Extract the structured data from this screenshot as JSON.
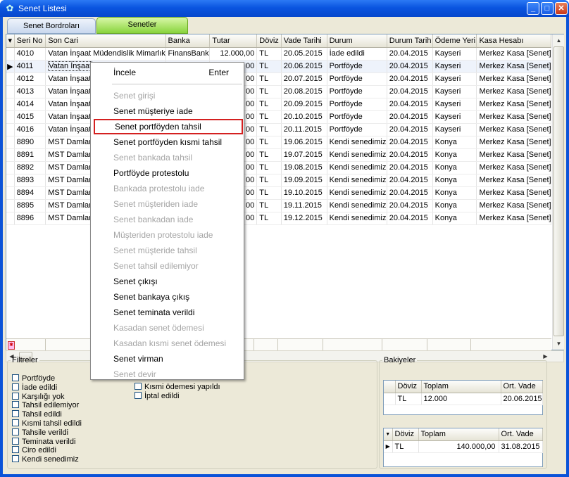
{
  "window": {
    "title": "Senet Listesi",
    "controls": {
      "minimize": "_",
      "maximize": "□",
      "close": "✕"
    }
  },
  "tabs": [
    {
      "label": "Senet Bordroları",
      "active": false
    },
    {
      "label": "Senetler",
      "active": true
    }
  ],
  "grid": {
    "columns": [
      "Seri No",
      "Son Cari",
      "Banka",
      "Tutar",
      "Döviz",
      "Vade Tarihi",
      "Durum",
      "Durum Tarih",
      "Ödeme Yeri",
      "Kasa Hesabı"
    ],
    "rows": [
      [
        "4010",
        "Vatan İnşaat Müdendislik Mimarlık",
        "FinansBank",
        "12.000,00",
        "TL",
        "20.05.2015",
        "İade edildi",
        "20.04.2015",
        "Kayseri",
        "Merkez Kasa [Senet]"
      ],
      [
        "4011",
        "Vatan İnşaat",
        "",
        "00",
        "TL",
        "20.06.2015",
        "Portföyde",
        "20.04.2015",
        "Kayseri",
        "Merkez Kasa [Senet]"
      ],
      [
        "4012",
        "Vatan İnşaat",
        "",
        "00",
        "TL",
        "20.07.2015",
        "Portföyde",
        "20.04.2015",
        "Kayseri",
        "Merkez Kasa [Senet]"
      ],
      [
        "4013",
        "Vatan İnşaat",
        "",
        "00",
        "TL",
        "20.08.2015",
        "Portföyde",
        "20.04.2015",
        "Kayseri",
        "Merkez Kasa [Senet]"
      ],
      [
        "4014",
        "Vatan İnşaat",
        "",
        "00",
        "TL",
        "20.09.2015",
        "Portföyde",
        "20.04.2015",
        "Kayseri",
        "Merkez Kasa [Senet]"
      ],
      [
        "4015",
        "Vatan İnşaat",
        "",
        "00",
        "TL",
        "20.10.2015",
        "Portföyde",
        "20.04.2015",
        "Kayseri",
        "Merkez Kasa [Senet]"
      ],
      [
        "4016",
        "Vatan İnşaat",
        "",
        "00",
        "TL",
        "20.11.2015",
        "Portföyde",
        "20.04.2015",
        "Kayseri",
        "Merkez Kasa [Senet]"
      ],
      [
        "8890",
        "MST Damlam",
        "",
        "00",
        "TL",
        "19.06.2015",
        "Kendi senedimiz",
        "20.04.2015",
        "Konya",
        "Merkez Kasa [Senet]"
      ],
      [
        "8891",
        "MST Damlam",
        "",
        "00",
        "TL",
        "19.07.2015",
        "Kendi senedimiz",
        "20.04.2015",
        "Konya",
        "Merkez Kasa [Senet]"
      ],
      [
        "8892",
        "MST Damlam",
        "",
        "00",
        "TL",
        "19.08.2015",
        "Kendi senedimiz",
        "20.04.2015",
        "Konya",
        "Merkez Kasa [Senet]"
      ],
      [
        "8893",
        "MST Damlam",
        "",
        "00",
        "TL",
        "19.09.2015",
        "Kendi senedimiz",
        "20.04.2015",
        "Konya",
        "Merkez Kasa [Senet]"
      ],
      [
        "8894",
        "MST Damlam",
        "",
        "00",
        "TL",
        "19.10.2015",
        "Kendi senedimiz",
        "20.04.2015",
        "Konya",
        "Merkez Kasa [Senet]"
      ],
      [
        "8895",
        "MST Damlam",
        "",
        "00",
        "TL",
        "19.11.2015",
        "Kendi senedimiz",
        "20.04.2015",
        "Konya",
        "Merkez Kasa [Senet]"
      ],
      [
        "8896",
        "MST Damlam",
        "",
        "00",
        "TL",
        "19.12.2015",
        "Kendi senedimiz",
        "20.04.2015",
        "Konya",
        "Merkez Kasa [Senet]"
      ]
    ],
    "selected_row": 1
  },
  "context_menu": {
    "items": [
      {
        "label": "İncele",
        "shortcut": "Enter",
        "enabled": true
      },
      {
        "sep": true
      },
      {
        "label": "Senet girişi",
        "enabled": false
      },
      {
        "label": "Senet müşteriye iade",
        "enabled": true
      },
      {
        "label": "Senet portföyden tahsil",
        "enabled": true,
        "highlighted": true
      },
      {
        "label": "Senet portföyden kısmi tahsil",
        "enabled": true
      },
      {
        "label": "Senet bankada tahsil",
        "enabled": false
      },
      {
        "label": "Portföyde protestolu",
        "enabled": true
      },
      {
        "label": "Bankada protestolu iade",
        "enabled": false
      },
      {
        "label": "Senet müşteriden iade",
        "enabled": false
      },
      {
        "label": "Senet bankadan iade",
        "enabled": false
      },
      {
        "label": "Müşteriden protestolu iade",
        "enabled": false
      },
      {
        "label": "Senet müşteride tahsil",
        "enabled": false
      },
      {
        "label": "Senet tahsil edilemiyor",
        "enabled": false
      },
      {
        "label": "Senet çıkışı",
        "enabled": true
      },
      {
        "label": "Senet bankaya çıkış",
        "enabled": true
      },
      {
        "label": "Senet teminata verildi",
        "enabled": true
      },
      {
        "label": "Kasadan senet ödemesi",
        "enabled": false
      },
      {
        "label": "Kasadan kısmi senet ödemesi",
        "enabled": false
      },
      {
        "label": "Senet virman",
        "enabled": true
      },
      {
        "label": "Senet devir",
        "enabled": false
      }
    ]
  },
  "filters": {
    "title": "Filtreler",
    "col1": [
      "Portföyde",
      "İade edildi",
      "Karşılığı yok",
      "Tahsil edilemiyor",
      "Tahsil edildi",
      "Kısmi tahsil edildi",
      "Tahsile verildi",
      "Teminata verildi",
      "Ciro edildi",
      "Kendi senedimiz"
    ],
    "col2": [
      "Kısmi ödemesi yapıldı",
      "İptal edildi"
    ]
  },
  "balances": {
    "title": "Bakiyeler",
    "table1": {
      "columns": [
        "Döviz",
        "Toplam",
        "Ort. Vade"
      ],
      "row": [
        "TL",
        "12.000",
        "20.06.2015"
      ]
    },
    "table2": {
      "columns": [
        "Döviz",
        "Toplam",
        "Ort. Vade"
      ],
      "row": [
        "TL",
        "140.000,00",
        "31.08.2015"
      ]
    }
  },
  "colors": {
    "titlebar": "#0a55e0",
    "active_tab": "#88d43c",
    "highlight_border": "#d42020"
  }
}
